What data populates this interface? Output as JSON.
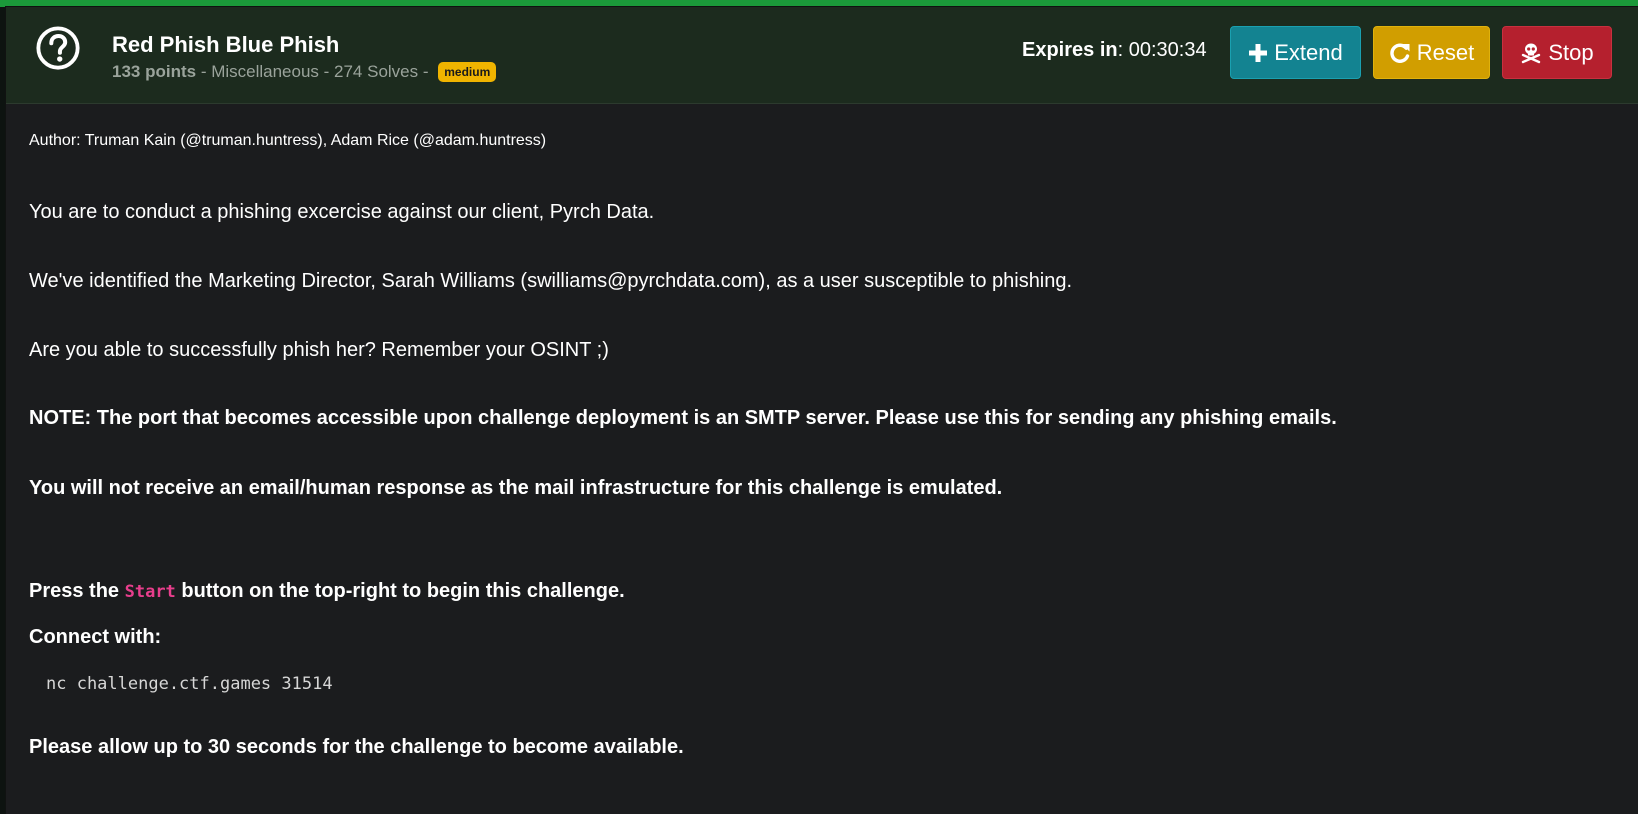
{
  "challenge": {
    "title": "Red Phish Blue Phish",
    "points": "133 points",
    "category_text": " - Miscellaneous - 274 Solves - ",
    "difficulty": "medium"
  },
  "timer": {
    "label": "Expires in",
    "value": ": 00:30:34"
  },
  "buttons": {
    "extend_label": "Extend",
    "reset_label": "Reset",
    "stop_label": "Stop"
  },
  "description": {
    "author": "Author: Truman Kain (@truman.huntress), Adam Rice (@adam.huntress)",
    "p1": "You are to conduct a phishing excercise against our client, Pyrch Data.",
    "p2": "We've identified the Marketing Director, Sarah Williams (swilliams@pyrchdata.com), as a user susceptible to phishing.",
    "p3": "Are you able to successfully phish her? Remember your OSINT ;)",
    "note": "NOTE: The port that becomes accessible upon challenge deployment is an SMTP server. Please use this for sending any phishing emails.",
    "no_response": "You will not receive an email/human response as the mail infrastructure for this challenge is emulated.",
    "press_before": "Press the ",
    "press_code": "Start",
    "press_after": " button on the top-right to begin this challenge.",
    "connect_label": "Connect with:",
    "command": "nc challenge.ctf.games 31514",
    "allow": "Please allow up to 30 seconds for the challenge to become available."
  },
  "icons": {
    "help": "question-circle-icon",
    "extend": "plus-icon",
    "reset": "redo-icon",
    "stop": "skull-crossbones-icon"
  },
  "colors": {
    "extend": "#138391",
    "reset": "#d19e00",
    "stop": "#b5202e",
    "badge": "#f0b400",
    "inline_code": "#e83e8c",
    "accent": "#1b9a3a"
  }
}
